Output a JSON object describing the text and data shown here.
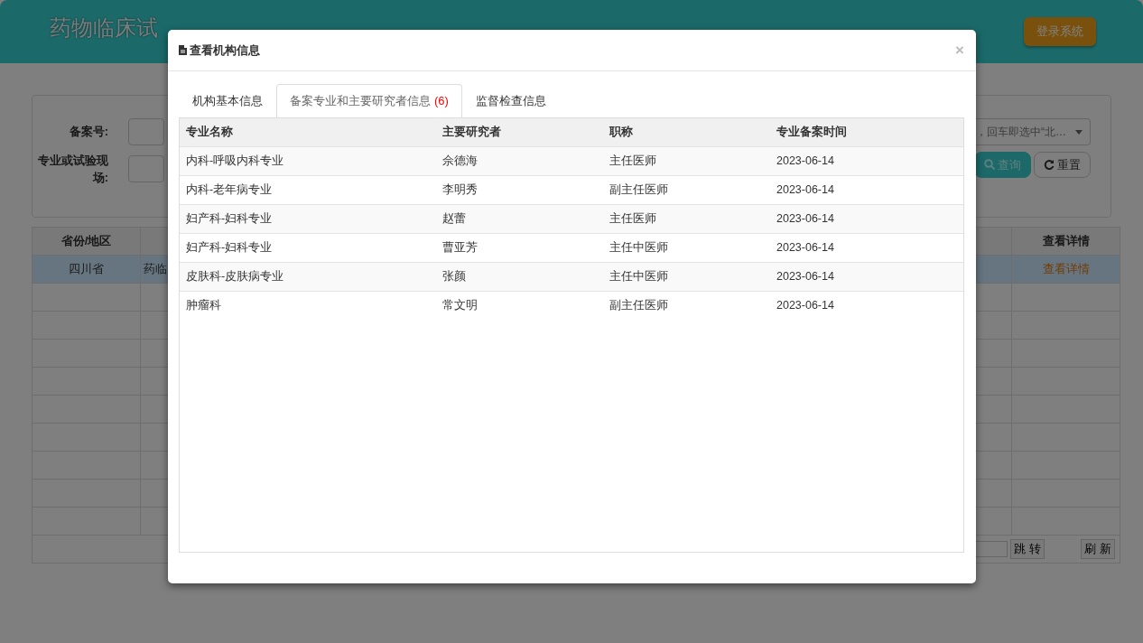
{
  "header": {
    "title": "药物临床试",
    "login_button": "登录系统"
  },
  "search_form": {
    "fields": [
      {
        "label": "备案号:"
      },
      {
        "label": "专业或试验现场:"
      }
    ],
    "select": {
      "value": "，回车即选中“北…"
    },
    "buttons": [
      {
        "label": "查询",
        "kind": "primary"
      },
      {
        "label": "重置",
        "kind": "default"
      }
    ]
  },
  "results_table": {
    "columns": [
      {
        "label": "省份/地区"
      },
      {
        "label": "查看详情"
      }
    ],
    "rows": [
      {
        "province": "四川省",
        "name": "药临",
        "link": "查看详情",
        "selected": true
      }
    ],
    "pagination": {
      "jump_button": "跳 转",
      "refresh_button": "刷 新"
    }
  },
  "modal": {
    "title": "查看机构信息",
    "close": "×",
    "tabs": [
      {
        "label": "机构基本信息",
        "selected": false
      },
      {
        "label": "备案专业和主要研究者信息",
        "count": "(6)",
        "selected": true
      },
      {
        "label": "监督检查信息",
        "selected": false
      }
    ],
    "table": {
      "columns": [
        "专业名称",
        "主要研究者",
        "职称",
        "专业备案时间"
      ],
      "rows": [
        [
          "内科-呼吸内科专业",
          "佘德海",
          "主任医师",
          "2023-06-14"
        ],
        [
          "内科-老年病专业",
          "李明秀",
          "副主任医师",
          "2023-06-14"
        ],
        [
          "妇产科-妇科专业",
          "赵蕾",
          "主任医师",
          "2023-06-14"
        ],
        [
          "妇产科-妇科专业",
          "曹亚芳",
          "主任中医师",
          "2023-06-14"
        ],
        [
          "皮肤科-皮肤病专业",
          "张颜",
          "主任中医师",
          "2023-06-14"
        ],
        [
          "肿瘤科",
          "常文明",
          "副主任医师",
          "2023-06-14"
        ]
      ]
    }
  }
}
